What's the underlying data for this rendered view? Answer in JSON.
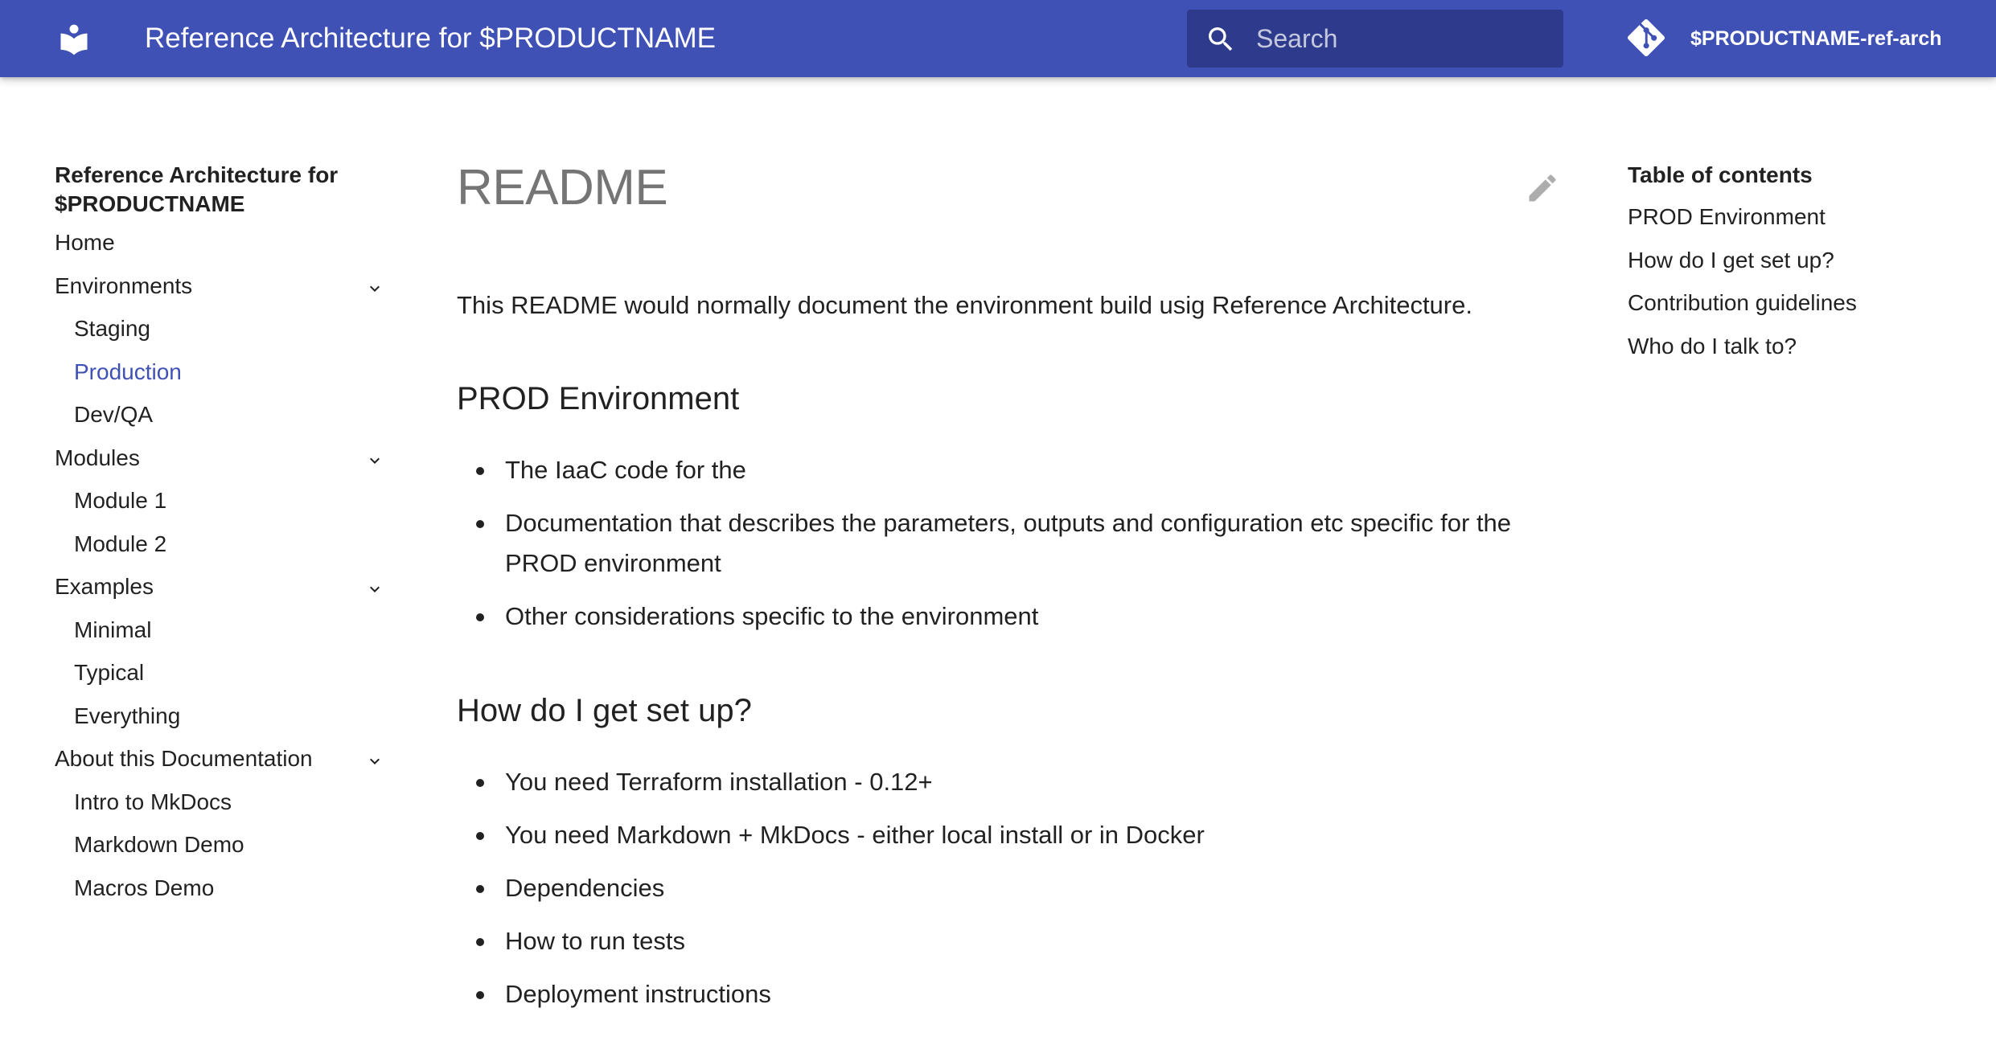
{
  "header": {
    "site_title": "Reference Architecture for $PRODUCTNAME",
    "logo_icon": "book-icon",
    "search": {
      "placeholder": "Search",
      "icon": "search-icon"
    },
    "repo": {
      "name": "$PRODUCTNAME-ref-arch",
      "icon": "git-icon"
    },
    "background_color": "#4051b5",
    "search_background": "#2e3b8c"
  },
  "nav": {
    "title": "Reference Architecture for $PRODUCTNAME",
    "active_color": "#4051b5",
    "items": [
      {
        "label": "Home"
      },
      {
        "label": "Environments",
        "expanded": true,
        "children": [
          "Staging",
          "Production",
          "Dev/QA"
        ]
      },
      {
        "label": "Modules",
        "expanded": true,
        "children": [
          "Module 1",
          "Module 2"
        ]
      },
      {
        "label": "Examples",
        "expanded": true,
        "children": [
          "Minimal",
          "Typical",
          "Everything"
        ]
      },
      {
        "label": "About this Documentation",
        "expanded": true,
        "children": [
          "Intro to MkDocs",
          "Markdown Demo",
          "Macros Demo"
        ]
      }
    ],
    "active_item": "Production"
  },
  "content": {
    "title": "README",
    "edit_icon": "pencil-icon",
    "intro": "This README would normally document the environment build usig Reference Architecture.",
    "sections": [
      {
        "heading": "PROD Environment",
        "bullets": [
          "The IaaC code for the",
          "Documentation that describes the parameters, outputs and configuration etc specific for the PROD environment",
          "Other considerations specific to the environment"
        ]
      },
      {
        "heading": "How do I get set up?",
        "bullets": [
          "You need Terraform installation - 0.12+",
          "You need Markdown + MkDocs - either local install or in Docker",
          "Dependencies",
          "How to run tests",
          "Deployment instructions"
        ]
      }
    ]
  },
  "toc": {
    "title": "Table of contents",
    "items": [
      "PROD Environment",
      "How do I get set up?",
      "Contribution guidelines",
      "Who do I talk to?"
    ]
  }
}
